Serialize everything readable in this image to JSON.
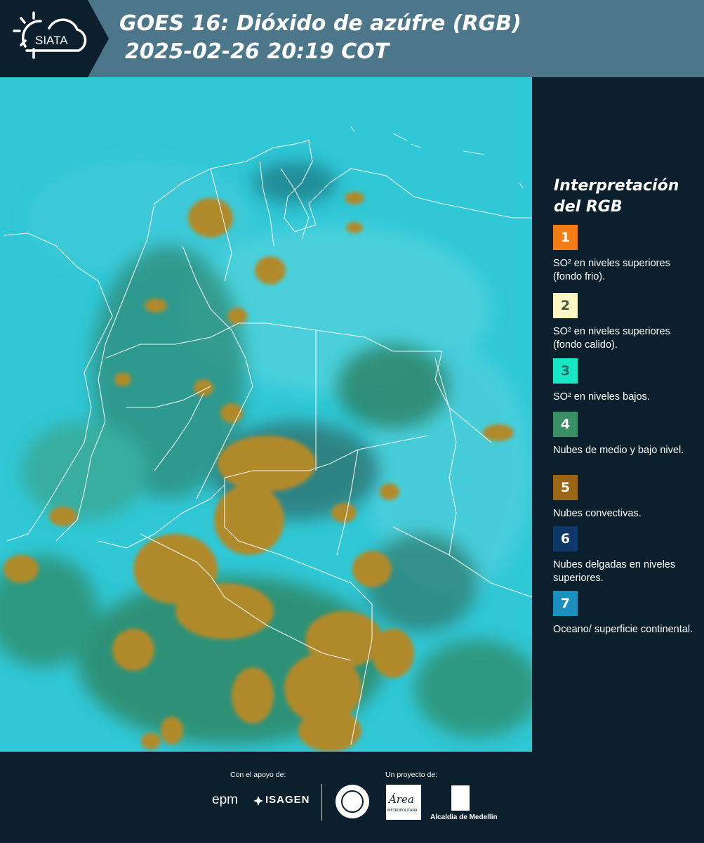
{
  "header": {
    "logo_text": "SIATA",
    "title_line1": "GOES 16: Dióxido de azúfre (RGB)",
    "title_line2": "2025-02-26 20:19 COT"
  },
  "legend": {
    "title_line1": "Interpretación",
    "title_line2": "del RGB",
    "items": [
      {
        "number": "1",
        "color": "#f07d16",
        "label": "SO² en niveles superiores (fondo frio)."
      },
      {
        "number": "2",
        "color": "#fcf6c4",
        "label": "SO² en niveles superiores (fondo calido)."
      },
      {
        "number": "3",
        "color": "#19e6c4",
        "label": "SO² en niveles bajos."
      },
      {
        "number": "4",
        "color": "#3a8f66",
        "label": "Nubes de medio y bajo nivel."
      },
      {
        "number": "5",
        "color": "#9b6516",
        "label": "Nubes convectivas."
      },
      {
        "number": "6",
        "color": "#0c3766",
        "label": "Nubes delgadas en niveles superiores."
      },
      {
        "number": "7",
        "color": "#1b8fbd",
        "label": "Oceano/ superficie continental."
      }
    ]
  },
  "footer": {
    "support_label": "Con el apoyo de:",
    "project_label": "Un proyecto de:",
    "epm_text": "epm",
    "isagen_text": "ISAGEN",
    "area_logo_text": "Área",
    "area_logo_sub": "METROPOLITANA",
    "alcaldia_text": "Alcaldía de Medellín"
  },
  "icons": [
    "siata-sun-cloud-icon",
    "isagen-icon",
    "medellin-seal-icon",
    "alcaldia-shield-icon"
  ]
}
